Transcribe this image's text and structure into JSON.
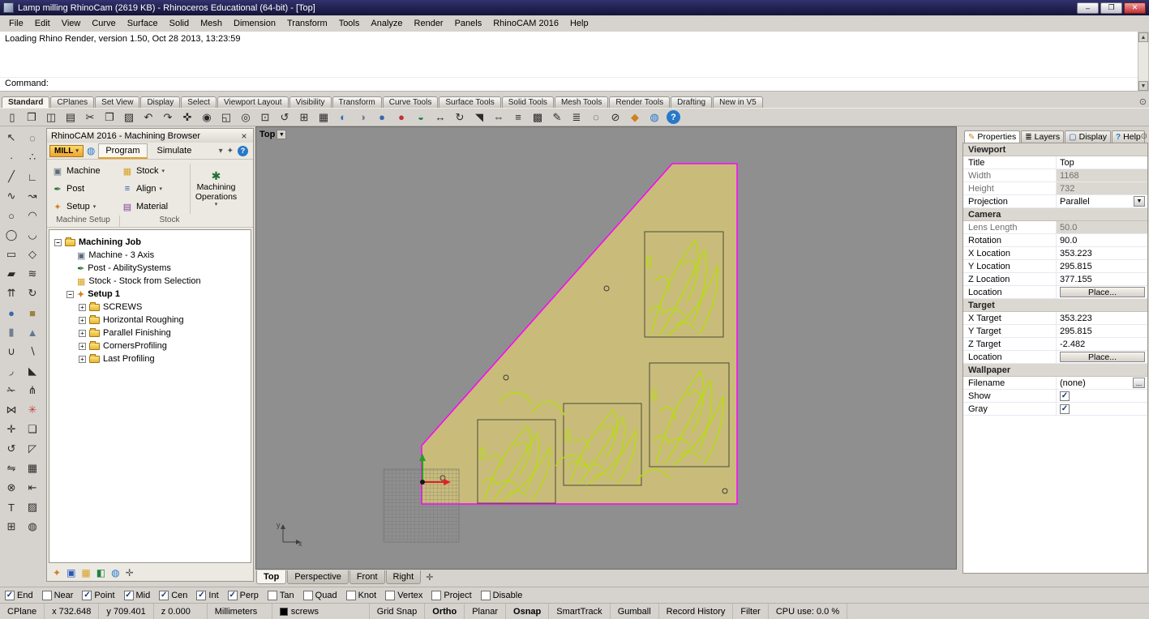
{
  "window": {
    "title": "Lamp milling RhinoCam (2619 KB) - Rhinoceros Educational (64-bit) - [Top]",
    "controls": {
      "minimize": "–",
      "maximize": "❐",
      "close": "✕"
    }
  },
  "menu": {
    "items": [
      "File",
      "Edit",
      "View",
      "Curve",
      "Surface",
      "Solid",
      "Mesh",
      "Dimension",
      "Transform",
      "Tools",
      "Analyze",
      "Render",
      "Panels",
      "RhinoCAM 2016",
      "Help"
    ]
  },
  "command": {
    "history_line": "Loading Rhino Render, version 1.50, Oct 28 2013, 13:23:59",
    "prompt": "Command:"
  },
  "toolbar_tabs": {
    "selected": "Standard",
    "items": [
      "Standard",
      "CPlanes",
      "Set View",
      "Display",
      "Select",
      "Viewport Layout",
      "Visibility",
      "Transform",
      "Curve Tools",
      "Surface Tools",
      "Solid Tools",
      "Mesh Tools",
      "Render Tools",
      "Drafting",
      "New in V5"
    ]
  },
  "main_toolbar": {
    "icons": [
      {
        "name": "new-file-icon",
        "glyph": "▯"
      },
      {
        "name": "open-file-icon",
        "glyph": "❒"
      },
      {
        "name": "save-file-icon",
        "glyph": "◫"
      },
      {
        "name": "print-icon",
        "glyph": "▤"
      },
      {
        "name": "cut-icon",
        "glyph": "✂"
      },
      {
        "name": "copy-icon",
        "glyph": "❐"
      },
      {
        "name": "paste-icon",
        "glyph": "▨"
      },
      {
        "name": "undo-icon",
        "glyph": "↶"
      },
      {
        "name": "redo-icon",
        "glyph": "↷"
      },
      {
        "name": "pan-view-icon",
        "glyph": "✜"
      },
      {
        "name": "zoom-dynamic-icon",
        "glyph": "◉"
      },
      {
        "name": "zoom-window-icon",
        "glyph": "◱"
      },
      {
        "name": "zoom-selected-icon",
        "glyph": "◎"
      },
      {
        "name": "zoom-extents-icon",
        "glyph": "⊡"
      },
      {
        "name": "undo-view-icon",
        "glyph": "↺"
      },
      {
        "name": "viewport-layout-icon",
        "glyph": "⊞"
      },
      {
        "name": "named-views-icon",
        "glyph": "▦"
      },
      {
        "name": "shaded-viewport-icon",
        "glyph": "◐",
        "color": "#3868b0"
      },
      {
        "name": "ghosted-viewport-icon",
        "glyph": "◑",
        "color": "#708090"
      },
      {
        "name": "rendered-viewport-icon",
        "glyph": "●",
        "color": "#3868b0"
      },
      {
        "name": "render-icon",
        "glyph": "●",
        "color": "#c03030"
      },
      {
        "name": "render-preview-icon",
        "glyph": "◒",
        "color": "#208040"
      },
      {
        "name": "move-icon",
        "glyph": "↔"
      },
      {
        "name": "rotate-icon",
        "glyph": "↻"
      },
      {
        "name": "scale-icon",
        "glyph": "◥"
      },
      {
        "name": "mirror-icon",
        "glyph": "⇔"
      },
      {
        "name": "offset-icon",
        "glyph": "≡"
      },
      {
        "name": "array-icon",
        "glyph": "▩"
      },
      {
        "name": "object-properties-icon",
        "glyph": "✎"
      },
      {
        "name": "layers-dialog-icon",
        "glyph": "≣"
      },
      {
        "name": "hide-objects-icon",
        "glyph": "◌"
      },
      {
        "name": "lock-objects-icon",
        "glyph": "⊘"
      },
      {
        "name": "gumball-toggle-icon",
        "glyph": "◆",
        "color": "#d08020"
      },
      {
        "name": "world-globe-icon",
        "glyph": "◍",
        "color": "#2878c8"
      },
      {
        "name": "help-ball-icon",
        "glyph": "?",
        "color": "#ffffff",
        "bg": "#2878c8",
        "round": true
      }
    ]
  },
  "left_palette": {
    "icons": [
      {
        "name": "select-arrow-icon",
        "glyph": "↖"
      },
      {
        "name": "lasso-select-icon",
        "glyph": "◌"
      },
      {
        "name": "point-icon",
        "glyph": "∙"
      },
      {
        "name": "point-cloud-icon",
        "glyph": "∴"
      },
      {
        "name": "line-icon",
        "glyph": "╱"
      },
      {
        "name": "polyline-icon",
        "glyph": "∟"
      },
      {
        "name": "curve-icon",
        "glyph": "∿"
      },
      {
        "name": "interp-curve-icon",
        "glyph": "↝"
      },
      {
        "name": "circle-icon",
        "glyph": "○"
      },
      {
        "name": "arc-icon",
        "glyph": "◠"
      },
      {
        "name": "ellipse-icon",
        "glyph": "◯"
      },
      {
        "name": "conic-icon",
        "glyph": "◡"
      },
      {
        "name": "rectangle-icon",
        "glyph": "▭"
      },
      {
        "name": "polygon-icon",
        "glyph": "◇"
      },
      {
        "name": "plane-surface-icon",
        "glyph": "▰"
      },
      {
        "name": "loft-icon",
        "glyph": "≋"
      },
      {
        "name": "extrude-icon",
        "glyph": "⇈"
      },
      {
        "name": "revolve-icon",
        "glyph": "↻"
      },
      {
        "name": "sphere-icon",
        "glyph": "●",
        "color": "#3868b0"
      },
      {
        "name": "box-icon",
        "glyph": "■",
        "color": "#a08040"
      },
      {
        "name": "cylinder-icon",
        "glyph": "▮",
        "color": "#708090"
      },
      {
        "name": "cone-icon",
        "glyph": "▲",
        "color": "#607890"
      },
      {
        "name": "boolean-union-icon",
        "glyph": "∪"
      },
      {
        "name": "boolean-diff-icon",
        "glyph": "∖"
      },
      {
        "name": "fillet-icon",
        "glyph": "◞"
      },
      {
        "name": "chamfer-icon",
        "glyph": "◣"
      },
      {
        "name": "trim-icon",
        "glyph": "✁"
      },
      {
        "name": "split-icon",
        "glyph": "⋔"
      },
      {
        "name": "join-icon",
        "glyph": "⋈"
      },
      {
        "name": "explode-icon",
        "glyph": "✳",
        "color": "#c04040"
      },
      {
        "name": "move-object-icon",
        "glyph": "✛"
      },
      {
        "name": "copy-object-icon",
        "glyph": "❏"
      },
      {
        "name": "rotate-object-icon",
        "glyph": "↺"
      },
      {
        "name": "scale-object-icon",
        "glyph": "◸"
      },
      {
        "name": "mirror-object-icon",
        "glyph": "⇋"
      },
      {
        "name": "array-object-icon",
        "glyph": "▦"
      },
      {
        "name": "curve-boolean-icon",
        "glyph": "⊗"
      },
      {
        "name": "dimension-icon",
        "glyph": "⇤"
      },
      {
        "name": "text-object-icon",
        "glyph": "T"
      },
      {
        "name": "hatch-icon",
        "glyph": "▨"
      },
      {
        "name": "block-icon",
        "glyph": "⊞"
      },
      {
        "name": "visibility-icon",
        "glyph": "◍"
      }
    ]
  },
  "machining_browser": {
    "title": "RhinoCAM 2016 - Machining Browser",
    "mill_label": "MILL",
    "tabs": [
      "Program",
      "Simulate"
    ],
    "selected_tab": "Program",
    "mini_icons": [
      {
        "name": "caret-down-icon",
        "glyph": "▾"
      },
      {
        "name": "browser-options-icon",
        "glyph": "✦"
      },
      {
        "name": "browser-help-icon",
        "glyph": "?"
      }
    ],
    "ribbon": {
      "buttons": [
        {
          "label": "Machine",
          "glyph": "▣",
          "dropdown": false
        },
        {
          "label": "Post",
          "glyph": "✒",
          "dropdown": false
        },
        {
          "label": "Setup",
          "glyph": "✦",
          "dropdown": true
        },
        {
          "label": "Stock",
          "glyph": "▦",
          "dropdown": true
        },
        {
          "label": "Align",
          "glyph": "≡",
          "dropdown": true
        },
        {
          "label": "Material",
          "glyph": "▤",
          "dropdown": false
        },
        {
          "label": "Machining Operations",
          "glyph": "✱",
          "dropdown": true
        }
      ],
      "group_labels": [
        "Machine Setup",
        "Stock"
      ]
    },
    "tree": [
      {
        "label": "Machining Job",
        "level": 0,
        "bold": true,
        "icon": "folder",
        "toggle": "minus"
      },
      {
        "label": "Machine - 3 Axis",
        "level": 1,
        "icon": "machine",
        "machine_glyph": "▣"
      },
      {
        "label": "Post - AbilitySystems",
        "level": 1,
        "icon": "post",
        "machine_glyph": "✒"
      },
      {
        "label": "Stock - Stock from Selection",
        "level": 1,
        "icon": "stock",
        "machine_glyph": "▦"
      },
      {
        "label": "Setup 1",
        "level": 1,
        "bold": true,
        "icon": "setup",
        "machine_glyph": "✦",
        "toggle": "minus"
      },
      {
        "label": "SCREWS",
        "level": 2,
        "icon": "folder",
        "toggle": "plus"
      },
      {
        "label": "Horizontal Roughing",
        "level": 2,
        "icon": "folder",
        "toggle": "plus"
      },
      {
        "label": "Parallel Finishing",
        "level": 2,
        "icon": "folder",
        "toggle": "plus"
      },
      {
        "label": "CornersProfiling",
        "level": 2,
        "icon": "folder",
        "toggle": "plus"
      },
      {
        "label": "Last Profiling",
        "level": 2,
        "icon": "folder",
        "toggle": "plus"
      }
    ],
    "bottom_icons": [
      {
        "name": "browser-settings-icon",
        "glyph": "✦",
        "color": "#d08020"
      },
      {
        "name": "toolpath-visibility-icon",
        "glyph": "▣",
        "color": "#2858b8"
      },
      {
        "name": "stock-visibility-icon",
        "glyph": "▦",
        "color": "#d8a020"
      },
      {
        "name": "material-sim-icon",
        "glyph": "◧",
        "color": "#208040"
      },
      {
        "name": "world-cs-icon",
        "glyph": "◍",
        "color": "#2878c8"
      },
      {
        "name": "tool-crib-icon",
        "glyph": "✛",
        "color": "#555555"
      }
    ]
  },
  "viewport": {
    "title_chip": "Top",
    "bg_color": "#8f8f8f",
    "model": {
      "fill": "#c9bc7a",
      "outline": "#ff00ff",
      "engraving_color": "#b5e000"
    },
    "tabs": [
      "Top",
      "Perspective",
      "Front",
      "Right"
    ],
    "selected_tab": "Top"
  },
  "properties_panel": {
    "tabs": [
      {
        "label": "Properties",
        "icon_name": "properties-tab-icon",
        "glyph": "✎"
      },
      {
        "label": "Layers",
        "icon_name": "layers-tab-icon",
        "glyph": "≣"
      },
      {
        "label": "Display",
        "icon_name": "display-tab-icon",
        "glyph": "▢"
      },
      {
        "label": "Help",
        "icon_name": "help-tab-icon",
        "glyph": "?"
      }
    ],
    "selected_tab": "Properties",
    "sections": [
      {
        "title": "Viewport",
        "rows": [
          {
            "label": "Title",
            "value": "Top",
            "type": "text"
          },
          {
            "label": "Width",
            "value": "1168",
            "type": "text",
            "disabled": true
          },
          {
            "label": "Height",
            "value": "732",
            "type": "text",
            "disabled": true
          },
          {
            "label": "Projection",
            "value": "Parallel",
            "type": "dropdown"
          }
        ]
      },
      {
        "title": "Camera",
        "rows": [
          {
            "label": "Lens Length",
            "value": "50.0",
            "type": "text",
            "disabled": true
          },
          {
            "label": "Rotation",
            "value": "90.0",
            "type": "text"
          },
          {
            "label": "X Location",
            "value": "353.223",
            "type": "text"
          },
          {
            "label": "Y Location",
            "value": "295.815",
            "type": "text"
          },
          {
            "label": "Z Location",
            "value": "377.155",
            "type": "text"
          },
          {
            "label": "Location",
            "value": "Place...",
            "type": "button"
          }
        ]
      },
      {
        "title": "Target",
        "rows": [
          {
            "label": "X Target",
            "value": "353.223",
            "type": "text"
          },
          {
            "label": "Y Target",
            "value": "295.815",
            "type": "text"
          },
          {
            "label": "Z Target",
            "value": "-2.482",
            "type": "text"
          },
          {
            "label": "Location",
            "value": "Place...",
            "type": "button"
          }
        ]
      },
      {
        "title": "Wallpaper",
        "rows": [
          {
            "label": "Filename",
            "value": "(none)",
            "type": "file"
          },
          {
            "label": "Show",
            "value": "",
            "type": "checkbox",
            "checked": true
          },
          {
            "label": "Gray",
            "value": "",
            "type": "checkbox",
            "checked": true
          }
        ]
      }
    ]
  },
  "osnap": {
    "items": [
      {
        "label": "End",
        "checked": true
      },
      {
        "label": "Near",
        "checked": false
      },
      {
        "label": "Point",
        "checked": true
      },
      {
        "label": "Mid",
        "checked": true
      },
      {
        "label": "Cen",
        "checked": true
      },
      {
        "label": "Int",
        "checked": true
      },
      {
        "label": "Perp",
        "checked": true
      },
      {
        "label": "Tan",
        "checked": false
      },
      {
        "label": "Quad",
        "checked": false
      },
      {
        "label": "Knot",
        "checked": false
      },
      {
        "label": "Vertex",
        "checked": false
      },
      {
        "label": "Project",
        "checked": false
      },
      {
        "label": "Disable",
        "checked": false
      }
    ]
  },
  "status_bar": {
    "items": [
      {
        "label": "CPlane",
        "w": "w46"
      },
      {
        "label": "x 732.648",
        "w": "w66"
      },
      {
        "label": "y 709.401",
        "w": "w66"
      },
      {
        "label": "z 0.000",
        "w": "w66"
      },
      {
        "label": "Millimeters",
        "w": "w80"
      },
      {
        "label": "screws",
        "swatch": "#000000",
        "w": "w120"
      },
      {
        "label": "Grid Snap"
      },
      {
        "label": "Ortho",
        "bold": true
      },
      {
        "label": "Planar"
      },
      {
        "label": "Osnap",
        "bold": true
      },
      {
        "label": "SmartTrack"
      },
      {
        "label": "Gumball"
      },
      {
        "label": "Record History"
      },
      {
        "label": "Filter"
      },
      {
        "label": "CPU use: 0.0 %",
        "static": true
      }
    ]
  }
}
